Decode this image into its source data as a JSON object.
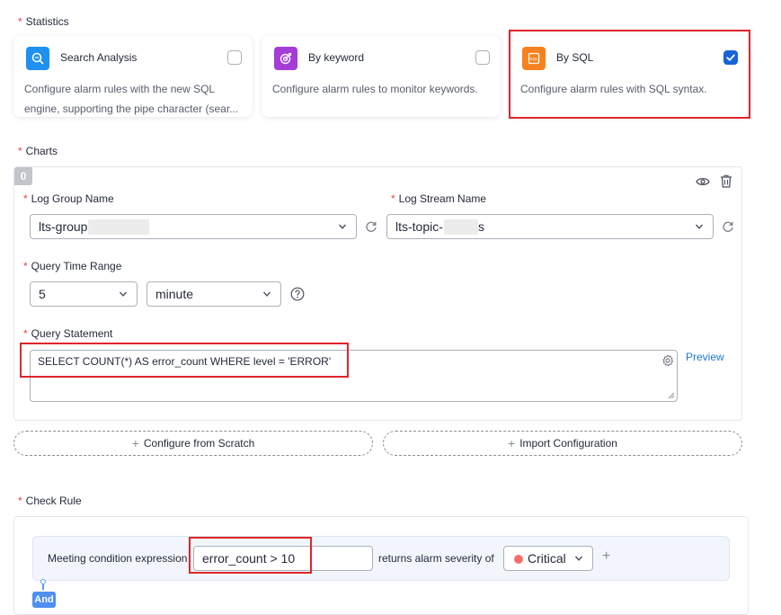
{
  "statistics": {
    "label": "Statistics",
    "cards": [
      {
        "title": "Search Analysis",
        "desc_line1": "Configure alarm rules with the new SQL",
        "desc_line2": "engine, supporting the pipe character (sear...",
        "checked": false,
        "color": "#1e90f0",
        "icon": "search-analysis-icon"
      },
      {
        "title": "By keyword",
        "desc_line1": "Configure alarm rules to monitor keywords.",
        "desc_line2": "",
        "checked": false,
        "color": "#a43cd8",
        "icon": "target-icon"
      },
      {
        "title": "By SQL",
        "desc_line1": "Configure alarm rules with SQL syntax.",
        "desc_line2": "",
        "checked": true,
        "color": "#f5821f",
        "icon": "sql-icon"
      }
    ]
  },
  "charts": {
    "label": "Charts",
    "index_badge": "0",
    "log_group_label": "Log Group Name",
    "log_group_value": "lts-group",
    "log_stream_label": "Log Stream Name",
    "log_stream_value": "lts-topic-",
    "log_stream_suffix": "s",
    "query_time_label": "Query Time Range",
    "query_time_value": "5",
    "query_time_unit": "minute",
    "query_statement_label": "Query Statement",
    "query_statement_value": "SELECT COUNT(*) AS error_count WHERE level = 'ERROR'",
    "preview_label": "Preview"
  },
  "buttons": {
    "configure_scratch": "Configure from Scratch",
    "import_config": "Import Configuration"
  },
  "check_rule": {
    "label": "Check Rule",
    "condition_label": "Meeting condition expression",
    "condition_value": "error_count > 10",
    "returns_label": "returns alarm severity of",
    "severity_value": "Critical",
    "severity_color": "#f66f6a",
    "and_label": "And"
  },
  "colors": {
    "accent": "#1764d9",
    "highlight": "#e0252b",
    "link": "#1e78d4"
  }
}
